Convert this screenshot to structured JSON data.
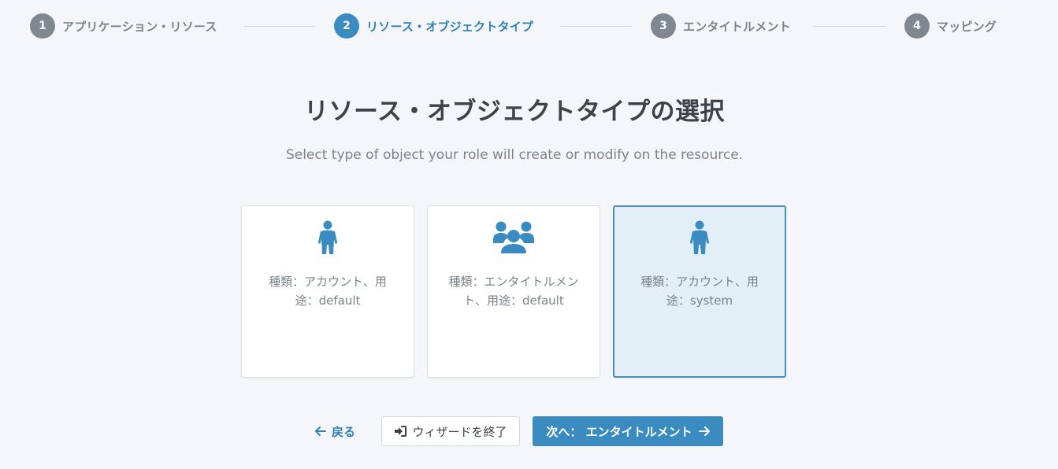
{
  "stepper": {
    "steps": [
      {
        "number": "1",
        "label": "アプリケーション・リソース",
        "active": false
      },
      {
        "number": "2",
        "label": "リソース・オブジェクトタイプ",
        "active": true
      },
      {
        "number": "3",
        "label": "エンタイトルメント",
        "active": false
      },
      {
        "number": "4",
        "label": "マッピング",
        "active": false
      }
    ]
  },
  "main": {
    "title": "リソース・オブジェクトタイプの選択",
    "subtitle": "Select type of object your role will create or modify on the resource."
  },
  "cards": [
    {
      "icon": "person-icon",
      "label": "種類：アカウント、用途：default",
      "selected": false
    },
    {
      "icon": "group-icon",
      "label": "種類：エンタイトルメント、用途：default",
      "selected": false
    },
    {
      "icon": "person-icon",
      "label": "種類：アカウント、用途：system",
      "selected": true
    }
  ],
  "footer": {
    "back_label": "戻る",
    "back_icon": "arrow-left-icon",
    "exit_label": "ウィザードを終了",
    "exit_icon": "sign-out-icon",
    "next_label": "次へ： エンタイトルメント",
    "next_icon": "arrow-right-icon"
  },
  "colors": {
    "accent": "#3a8bbf",
    "inactive_step": "#7f8891",
    "selected_card_bg": "#e3eff7",
    "background": "#f4f6f9"
  }
}
